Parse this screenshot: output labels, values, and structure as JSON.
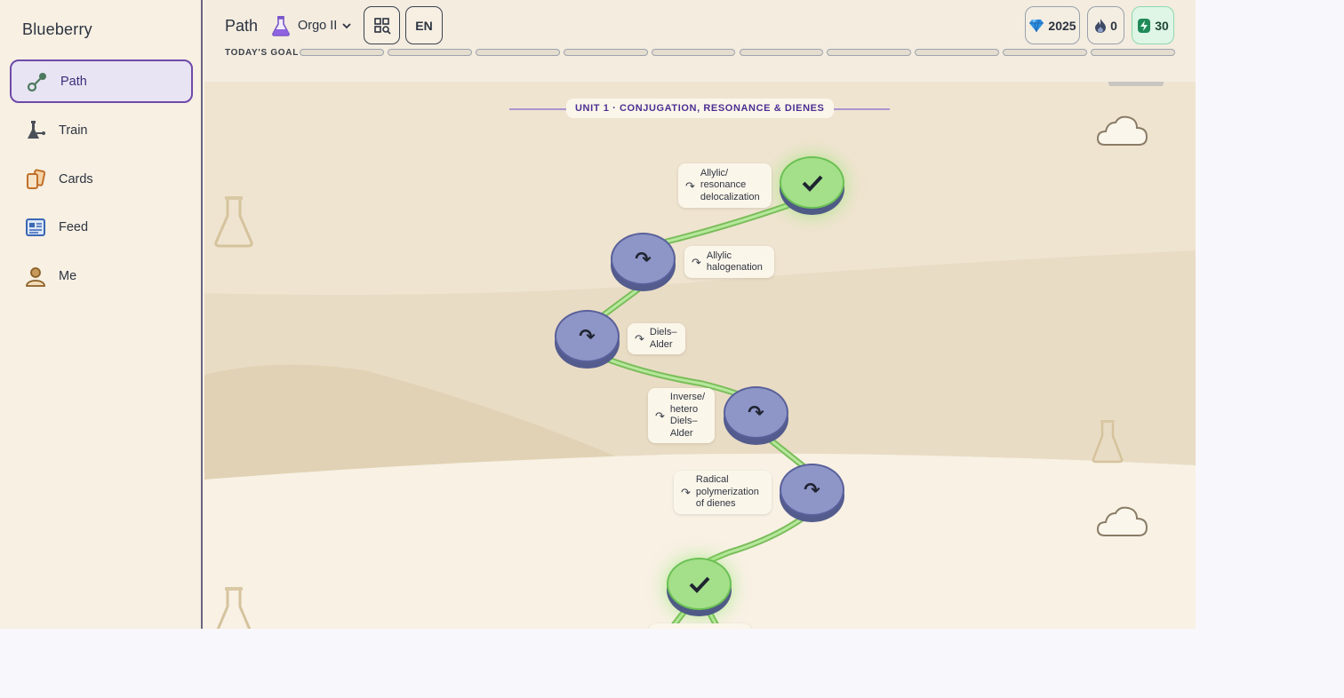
{
  "app": {
    "brand": "Blueberry"
  },
  "sidebar": {
    "items": [
      {
        "label": "Path",
        "icon": "path-icon",
        "active": true
      },
      {
        "label": "Train",
        "icon": "train-icon",
        "active": false
      },
      {
        "label": "Cards",
        "icon": "cards-icon",
        "active": false
      },
      {
        "label": "Feed",
        "icon": "feed-icon",
        "active": false
      },
      {
        "label": "Me",
        "icon": "me-icon",
        "active": false
      }
    ]
  },
  "header": {
    "title": "Path",
    "course": {
      "name": "Orgo II",
      "icon": "flask-icon"
    },
    "qr_icon": "qr-scan-icon",
    "language": "EN",
    "stats": {
      "gems": "2025",
      "streak": "0",
      "energy": "30"
    },
    "goal_label": "TODAY'S GOAL",
    "goal_segments": 10,
    "goal_progress": 0
  },
  "unit": {
    "title": "UNIT 1 · CONJUGATION, RESONANCE & DIENES"
  },
  "lessons": [
    {
      "label": "Allylic/ resonance delocalization",
      "status": "done"
    },
    {
      "label": "Allylic halogenation",
      "status": "locked"
    },
    {
      "label": "Diels–Alder",
      "status": "locked"
    },
    {
      "label": "Inverse/ hetero Diels– Alder",
      "status": "locked"
    },
    {
      "label": "Radical polymerization of dienes",
      "status": "locked"
    },
    {
      "label": "",
      "status": "done"
    }
  ],
  "colors": {
    "accent": "#6f4aa8",
    "done_node": "#a4df8a",
    "locked_node": "#8e95c7",
    "path_line": "#9bd47c"
  }
}
